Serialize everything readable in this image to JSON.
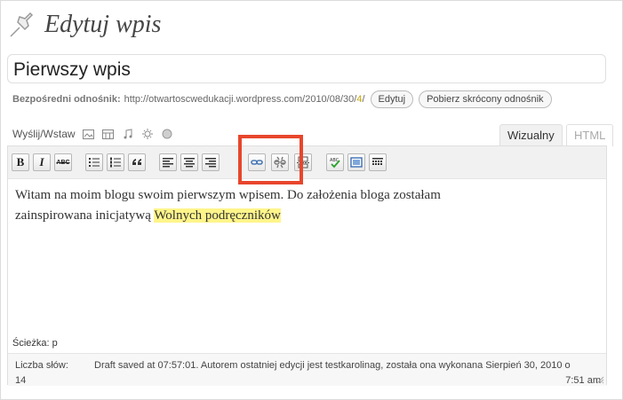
{
  "header": {
    "title": "Edytuj wpis",
    "icon": "pushpin-icon"
  },
  "post": {
    "title_value": "Pierwszy wpis"
  },
  "permalink": {
    "label": "Bezpośredni odnośnik:",
    "url_prefix": "http://otwartoscwedukacji.wordpress.com/2010/08/30/",
    "url_highlight": "4",
    "url_suffix": "/",
    "edit_label": "Edytuj",
    "shortlink_label": "Pobierz skrócony odnośnik"
  },
  "upload": {
    "label": "Wyślij/Wstaw"
  },
  "tabs": {
    "visual": "Wizualny",
    "html": "HTML"
  },
  "toolbar": {
    "bold": "B",
    "italic": "I",
    "strike": "ABC"
  },
  "content": {
    "line1": "Witam na moim blogu swoim pierwszym wpisem. Do założenia bloga zostałam",
    "line2_plain": "zainspirowana inicjatywą ",
    "line2_highlight": "Wolnych podręczników"
  },
  "path": "Ścieżka: p",
  "status": {
    "word_count_label": "Liczba słów:",
    "word_count": "14",
    "draft_line1": "Draft saved at 07:57:01. Autorem ostatniej edycji jest testkarolinag, została ona wykonana Sierpień 30, 2010 o",
    "draft_line2": "7:51 am"
  },
  "colors": {
    "highlight_box": "#e8462c",
    "text_highlight": "#fff58a"
  }
}
